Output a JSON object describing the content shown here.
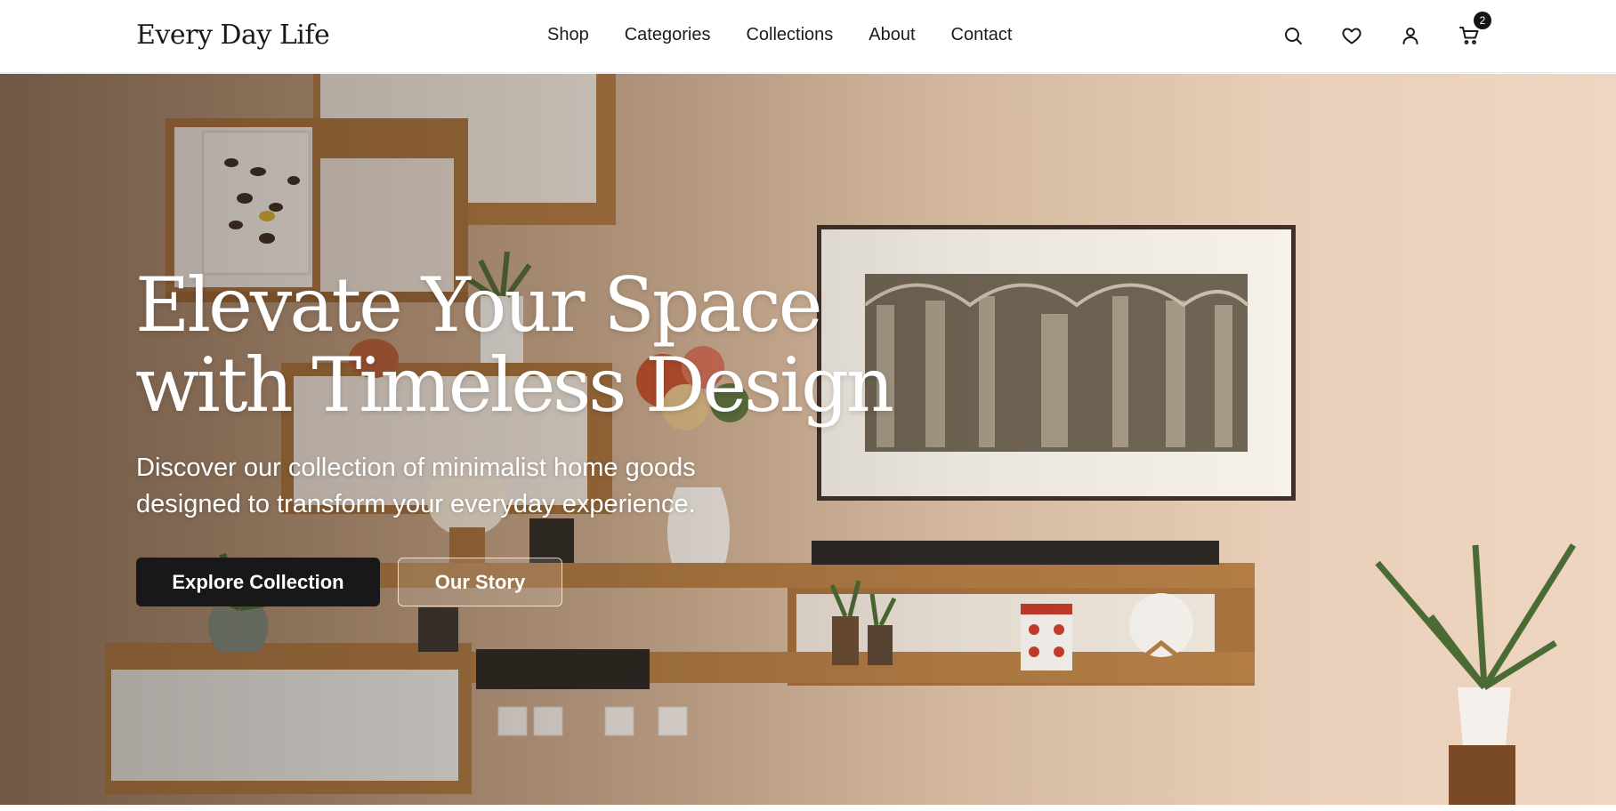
{
  "brand": {
    "name": "Every Day Life"
  },
  "nav": {
    "items": [
      {
        "label": "Shop"
      },
      {
        "label": "Categories"
      },
      {
        "label": "Collections"
      },
      {
        "label": "About"
      },
      {
        "label": "Contact"
      }
    ]
  },
  "header_icons": {
    "search": "search-icon",
    "wishlist": "heart-icon",
    "account": "user-icon",
    "cart": "cart-icon",
    "cart_count": "2"
  },
  "hero": {
    "title_line1": "Elevate Your Space",
    "title_line2": "with Timeless Design",
    "subtitle_line1": "Discover our collection of minimalist home goods",
    "subtitle_line2": "designed to transform your everyday experience.",
    "primary_cta": "Explore Collection",
    "secondary_cta": "Our Story"
  },
  "colors": {
    "primary_button": "#18181b",
    "header_bg": "#ffffff",
    "hero_text": "#ffffff"
  }
}
